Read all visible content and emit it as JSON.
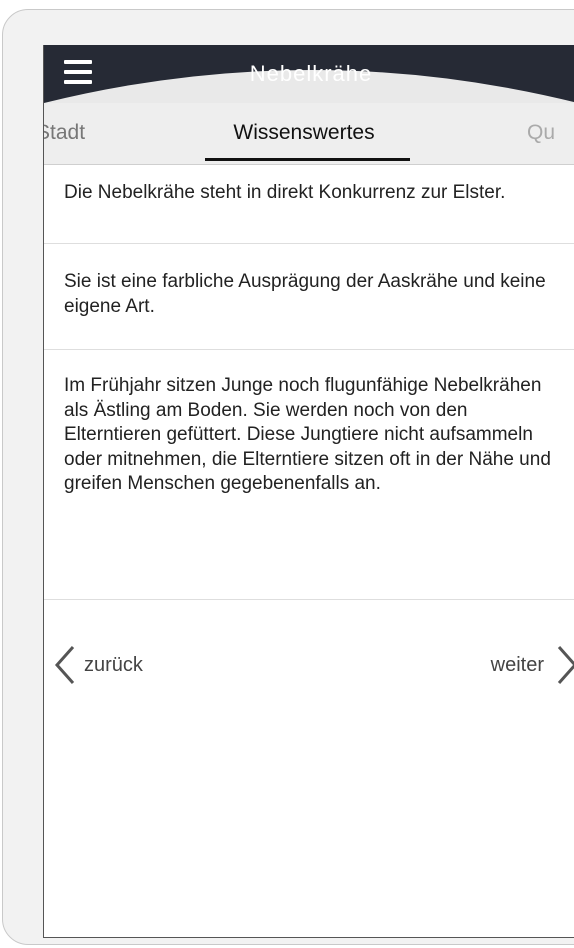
{
  "app": {
    "title": "Nebelkrähe"
  },
  "tabs": [
    {
      "label": "Stadt"
    },
    {
      "label": "Wissenswertes"
    },
    {
      "label": "Qu"
    }
  ],
  "facts": [
    {
      "text": "Die Nebelkrähe steht in direkt Konkurrenz zur Elster."
    },
    {
      "text": "Sie ist eine farbliche Ausprägung der Aaskrähe und keine eigene Art."
    },
    {
      "text": "Im Frühjahr sitzen Junge noch flugunfähige Nebelkrähen als Ästling am Boden. Sie werden noch von den Elterntieren gefüttert. Diese Jungtiere nicht aufsammeln oder mitnehmen, die Elterntiere sitzen oft in der Nähe und greifen Menschen gegebenenfalls an."
    }
  ],
  "nav": {
    "back_label": "zurück",
    "next_label": "weiter"
  },
  "colors": {
    "header": "#262a35",
    "header_curve": "#e9e9e9",
    "tab_bar": "#eeeeee"
  }
}
